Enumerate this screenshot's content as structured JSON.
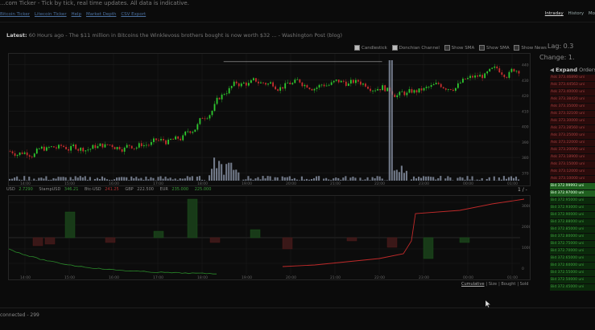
{
  "header": {
    "title": "...com Ticker - Tick by tick, real time updates. All data is indicative."
  },
  "nav": {
    "links": [
      "Bitcoin Ticker",
      "Litecoin Ticker",
      "Help",
      "Market Depth",
      "CSV Export"
    ]
  },
  "top_right_tabs": [
    {
      "label": "Intraday",
      "active": true
    },
    {
      "label": "History",
      "active": false
    },
    {
      "label": "Mo",
      "active": false
    }
  ],
  "latest": {
    "label": "Latest:",
    "text": "60 Hours ago - The $11 million in Bitcoins the Winklevoss brothers bought is now worth $32 ... - Washington Post (blog)"
  },
  "chart_toggles": [
    {
      "label": "Candlestick",
      "checked": true
    },
    {
      "label": "Donchian Channel",
      "checked": true
    },
    {
      "label": "Show SMA",
      "checked": false
    },
    {
      "label": "Show SMA",
      "checked": false
    },
    {
      "label": "Show News",
      "checked": false
    }
  ],
  "price_line": [
    {
      "label": "USD",
      "value": "2.7290",
      "color": "#3c9b3c"
    },
    {
      "label": "StampUSD",
      "value": "346.21",
      "color": "#3c9b3c"
    },
    {
      "label": "Btc-USD",
      "value": "241.25",
      "color": "#b23232"
    },
    {
      "label": "GBP",
      "value": "222.500",
      "color": "#888888"
    },
    {
      "label": "EUR",
      "value": "235.000",
      "color": "#3c9b3c"
    },
    {
      "label": "",
      "value": "225.000",
      "color": "#3c9b3c"
    }
  ],
  "zoom_control": "1 / -",
  "lower_tabs": [
    {
      "label": "Cumulative",
      "active": true
    },
    {
      "label": "Size",
      "active": false
    },
    {
      "label": "Bought",
      "active": false
    },
    {
      "label": "Sold",
      "active": false
    }
  ],
  "side": {
    "lag_label": "Lag: 0.3",
    "change_label": "Change: 1.",
    "expand_label": "Expand",
    "orders_label": "Orders",
    "orders": [
      {
        "type": "ask",
        "text": "Ask  373.46890  uni"
      },
      {
        "type": "ask",
        "text": "Ask  373.44563  uni"
      },
      {
        "type": "ask",
        "text": "Ask  373.40000  uni"
      },
      {
        "type": "ask",
        "text": "Ask  373.38420  uni"
      },
      {
        "type": "ask",
        "text": "Ask  373.35000  uni"
      },
      {
        "type": "ask",
        "text": "Ask  373.32100  uni"
      },
      {
        "type": "ask",
        "text": "Ask  373.30000  uni"
      },
      {
        "type": "ask",
        "text": "Ask  373.28560  uni"
      },
      {
        "type": "ask",
        "text": "Ask  373.25000  uni"
      },
      {
        "type": "ask",
        "text": "Ask  373.22000  uni"
      },
      {
        "type": "ask",
        "text": "Ask  373.20000  uni"
      },
      {
        "type": "ask",
        "text": "Ask  373.18900  uni"
      },
      {
        "type": "ask",
        "text": "Ask  373.15000  uni"
      },
      {
        "type": "ask",
        "text": "Ask  373.12000  uni"
      },
      {
        "type": "ask",
        "text": "Ask  373.10000  uni"
      },
      {
        "type": "hl",
        "text": "Bid  372.99993  uni"
      },
      {
        "type": "hl",
        "text": "Bid  372.97000  uni"
      },
      {
        "type": "bid",
        "text": "Bid  372.95000  uni"
      },
      {
        "type": "bid",
        "text": "Bid  372.93000  uni"
      },
      {
        "type": "bid",
        "text": "Bid  372.90000  uni"
      },
      {
        "type": "bid",
        "text": "Bid  372.88000  uni"
      },
      {
        "type": "bid",
        "text": "Bid  372.85000  uni"
      },
      {
        "type": "bid",
        "text": "Bid  372.80000  uni"
      },
      {
        "type": "bid",
        "text": "Bid  372.75000  uni"
      },
      {
        "type": "bid",
        "text": "Bid  372.70000  uni"
      },
      {
        "type": "bid",
        "text": "Bid  372.65000  uni"
      },
      {
        "type": "bid",
        "text": "Bid  372.60000  uni"
      },
      {
        "type": "bid",
        "text": "Bid  372.55000  uni"
      },
      {
        "type": "bid",
        "text": "Bid  372.50000  uni"
      },
      {
        "type": "bid",
        "text": "Bid  372.45000  uni"
      }
    ]
  },
  "status": "connected - 299",
  "chart_data": [
    {
      "type": "candlestick",
      "time_labels": [
        "14:00",
        "15:00",
        "16:00",
        "17:00",
        "18:00",
        "19:00",
        "20:00",
        "21:00",
        "22:00",
        "23:00",
        "00:00",
        "01:00"
      ],
      "y_labels": [
        "440",
        "430",
        "420",
        "410",
        "400",
        "390",
        "380",
        "370"
      ],
      "ylim": [
        365,
        445
      ],
      "colors": {
        "up": "#2fc92f",
        "down": "#c92f2f",
        "volume": "#8a94a6"
      }
    },
    {
      "type": "line",
      "time_labels": [
        "14:00",
        "15:00",
        "16:00",
        "17:00",
        "18:00",
        "19:00",
        "20:00",
        "21:00",
        "22:00",
        "23:00",
        "00:00",
        "01:00"
      ],
      "y_labels": [
        "3000",
        "2000",
        "1000",
        "0"
      ],
      "series": [
        {
          "color": "#2a8a2a",
          "values": [
            40,
            34,
            28,
            22,
            18,
            14,
            10,
            8,
            6,
            5,
            4,
            3
          ]
        },
        {
          "color": "#c02a2a",
          "values": [
            0,
            6,
            12,
            18,
            24,
            32,
            40,
            52,
            66,
            86,
            94,
            100
          ]
        }
      ]
    }
  ]
}
